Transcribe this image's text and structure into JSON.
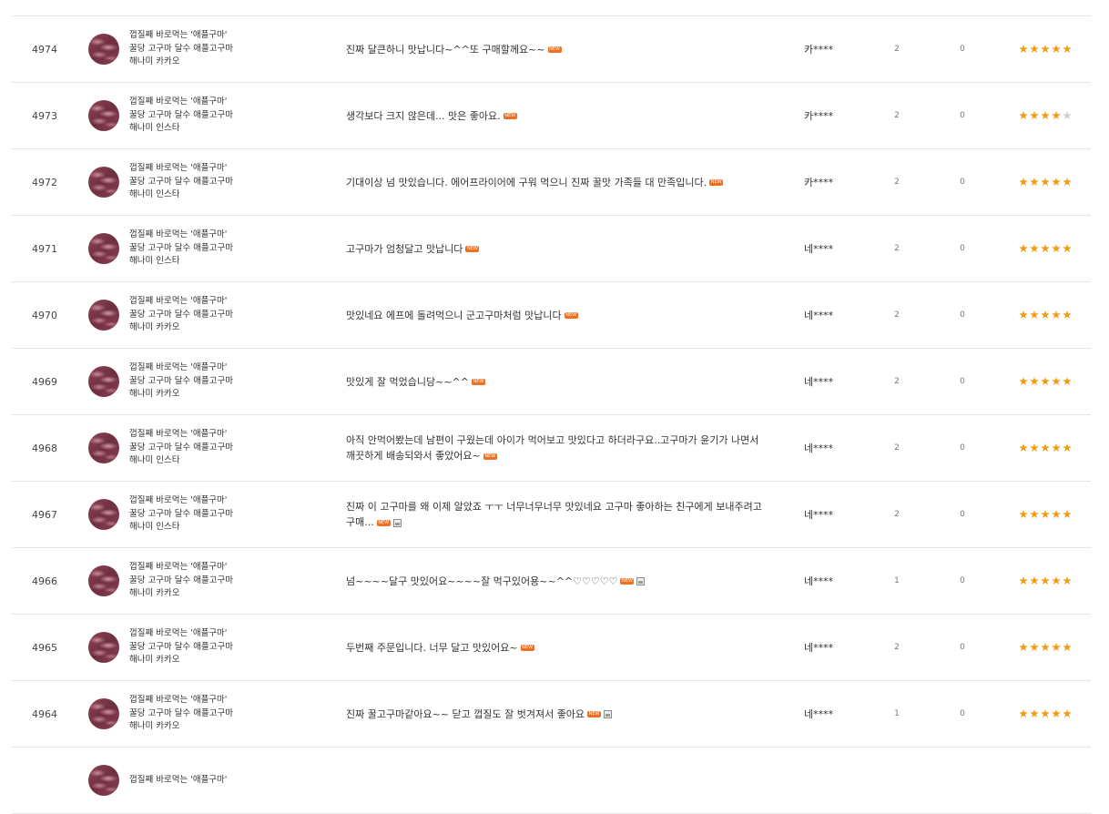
{
  "new_label": "NEW",
  "colors": {
    "star_on": "#f49a0c",
    "star_off": "#cfcfcf",
    "new_badge": "#f06f20",
    "divider": "#e6e6e6"
  },
  "reviews": [
    {
      "no": "4974",
      "product": [
        "껍질째 바로먹는 '애플구마'",
        "꿀당 고구마 달수 애플고구마",
        "해나미 카카오"
      ],
      "content": "진짜 달큰하니 맛납니다~^^또 구매할께요~~",
      "has_image": false,
      "author": "카****",
      "views": "2",
      "likes": "0",
      "stars": 5
    },
    {
      "no": "4973",
      "product": [
        "껍질째 바로먹는 '애플구마'",
        "꿀당 고구마 달수 애플고구마",
        "해나미 인스타"
      ],
      "content": "생각보다 크지 않은데... 맛은 좋아요.",
      "has_image": false,
      "author": "카****",
      "views": "2",
      "likes": "0",
      "stars": 4
    },
    {
      "no": "4972",
      "product": [
        "껍질째 바로먹는 '애플구마'",
        "꿀당 고구마 달수 애플고구마",
        "해나미 인스타"
      ],
      "content": "기대이상 넘 맛있습니다. 에어프라이어에 구워 먹으니 진짜 꿀맛 가족들 대 만족입니다.",
      "has_image": false,
      "author": "카****",
      "views": "2",
      "likes": "0",
      "stars": 5
    },
    {
      "no": "4971",
      "product": [
        "껍질째 바로먹는 '애플구마'",
        "꿀당 고구마 달수 애플고구마",
        "해나미 인스타"
      ],
      "content": "고구마가 엄청달고 맛납니다",
      "has_image": false,
      "author": "네****",
      "views": "2",
      "likes": "0",
      "stars": 5
    },
    {
      "no": "4970",
      "product": [
        "껍질째 바로먹는 '애플구마'",
        "꿀당 고구마 달수 애플고구마",
        "해나미 카카오"
      ],
      "content": "맛있네요 에프에 돌려먹으니 군고구마처럼 맛납니다",
      "has_image": false,
      "author": "네****",
      "views": "2",
      "likes": "0",
      "stars": 5
    },
    {
      "no": "4969",
      "product": [
        "껍질째 바로먹는 '애플구마'",
        "꿀당 고구마 달수 애플고구마",
        "해나미 카카오"
      ],
      "content": "맛있게 잘 먹었습니당~~^^",
      "has_image": false,
      "author": "네****",
      "views": "2",
      "likes": "0",
      "stars": 5
    },
    {
      "no": "4968",
      "product": [
        "껍질째 바로먹는 '애플구마'",
        "꿀당 고구마 달수 애플고구마",
        "해나미 인스타"
      ],
      "content": "아직 안먹어봤는데 남편이 구웠는데 아이가 먹어보고 맛있다고 하더라구요..고구마가 윤기가 나면서 깨끗하게 배송되와서 좋았어요~",
      "has_image": false,
      "author": "네****",
      "views": "2",
      "likes": "0",
      "stars": 5
    },
    {
      "no": "4967",
      "product": [
        "껍질째 바로먹는 '애플구마'",
        "꿀당 고구마 달수 애플고구마",
        "해나미 인스타"
      ],
      "content": "진짜 이 고구마를 왜 이제 알았죠 ㅜㅜ 너무너무너무 맛있네요 고구마 좋아하는 친구에게 보내주려고 구매...",
      "has_image": true,
      "author": "네****",
      "views": "2",
      "likes": "0",
      "stars": 5
    },
    {
      "no": "4966",
      "product": [
        "껍질째 바로먹는 '애플구마'",
        "꿀당 고구마 달수 애플고구마",
        "해나미 카카오"
      ],
      "content": "넘~~~~달구 맛있어요~~~~잘 먹구있어용~~^^♡♡♡♡♡",
      "has_image": true,
      "author": "네****",
      "views": "1",
      "likes": "0",
      "stars": 5
    },
    {
      "no": "4965",
      "product": [
        "껍질째 바로먹는 '애플구마'",
        "꿀당 고구마 달수 애플고구마",
        "해나미 카카오"
      ],
      "content": "두번째 주문입니다. 너무 달고 맛있어요~",
      "has_image": false,
      "author": "네****",
      "views": "2",
      "likes": "0",
      "stars": 5
    },
    {
      "no": "4964",
      "product": [
        "껍질째 바로먹는 '애플구마'",
        "꿀당 고구마 달수 애플고구마",
        "해나미 카카오"
      ],
      "content": "진짜 꿀고구마같아요~~ 닫고 껍질도 잘 벗겨져서 좋아요",
      "has_image": true,
      "author": "네****",
      "views": "1",
      "likes": "0",
      "stars": 5
    },
    {
      "no": "",
      "product": [
        "껍질째 바로먹는 '애플구마'",
        "",
        ""
      ],
      "content": "",
      "has_image": false,
      "author": "",
      "views": "",
      "likes": "",
      "stars": 0
    }
  ]
}
